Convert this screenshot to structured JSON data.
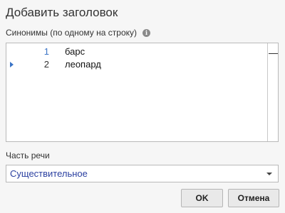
{
  "dialog": {
    "title": "Добавить заголовок",
    "synonyms_label": "Синонимы (по одному на строку)",
    "info_icon": "info-icon",
    "synonyms": [
      {
        "number": "1",
        "text": "барс"
      },
      {
        "number": "2",
        "text": "леопард"
      }
    ],
    "current_line": 2,
    "part_of_speech_label": "Часть речи",
    "part_of_speech_value": "Существительное",
    "ok_label": "OK",
    "cancel_label": "Отмена"
  },
  "colors": {
    "accent": "#3a74c6",
    "select_text": "#2a3fa0",
    "background": "#f6f6f6"
  }
}
